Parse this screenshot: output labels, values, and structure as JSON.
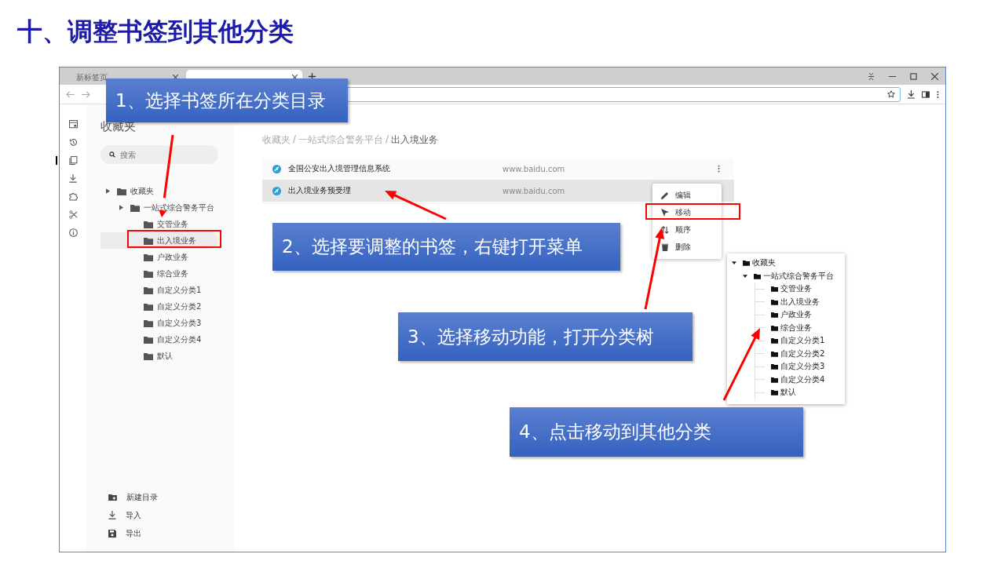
{
  "title": "十、调整书签到其他分类",
  "browser": {
    "tabs": [
      {
        "label": "新标签页",
        "selected": false
      },
      {
        "selected": true
      }
    ]
  },
  "sidebar": {
    "title": "收藏夹",
    "search_placeholder": "搜索",
    "tree": [
      {
        "label": "收藏夹",
        "selected": false,
        "children": [
          {
            "label": "一站式综合警务平台",
            "selected": false,
            "children": [
              {
                "label": "交管业务",
                "selected": false
              },
              {
                "label": "出入境业务",
                "selected": true
              },
              {
                "label": "户政业务",
                "selected": false
              },
              {
                "label": "综合业务",
                "selected": false
              },
              {
                "label": "自定义分类1",
                "selected": false
              },
              {
                "label": "自定义分类2",
                "selected": false
              },
              {
                "label": "自定义分类3",
                "selected": false
              },
              {
                "label": "自定义分类4",
                "selected": false
              },
              {
                "label": "默认",
                "selected": false
              }
            ]
          }
        ]
      }
    ],
    "actions": [
      {
        "label": "新建目录",
        "kind": "new-folder"
      },
      {
        "label": "导入",
        "kind": "import"
      },
      {
        "label": "导出",
        "kind": "export"
      }
    ]
  },
  "breadcrumb": {
    "separator": "/",
    "items": [
      "收藏夹",
      "一站式综合警务平台",
      "出入境业务"
    ]
  },
  "bookmarks": [
    {
      "title": "全国公安出入境管理信息系统",
      "url": "www.baidu.com",
      "selected": false
    },
    {
      "title": "出入境业务预受理",
      "url": "www.baidu.com",
      "selected": true
    }
  ],
  "context_menu": [
    {
      "label": "编辑",
      "kind": "edit"
    },
    {
      "label": "移动",
      "kind": "move"
    },
    {
      "label": "顺序",
      "kind": "order"
    },
    {
      "label": "删除",
      "kind": "delete"
    }
  ],
  "move_tree": [
    {
      "label": "收藏夹",
      "children": [
        {
          "label": "一站式综合警务平台",
          "children": [
            {
              "label": "交管业务"
            },
            {
              "label": "出入境业务"
            },
            {
              "label": "户政业务"
            },
            {
              "label": "综合业务"
            },
            {
              "label": "自定义分类1"
            },
            {
              "label": "自定义分类2"
            },
            {
              "label": "自定义分类3"
            },
            {
              "label": "自定义分类4"
            },
            {
              "label": "默认"
            }
          ]
        }
      ]
    }
  ],
  "callouts": [
    "1、选择书签所在分类目录",
    "2、选择要调整的书签，右键打开菜单",
    "3、选择移动功能，打开分类树",
    "4、点击移动到其他分类"
  ]
}
